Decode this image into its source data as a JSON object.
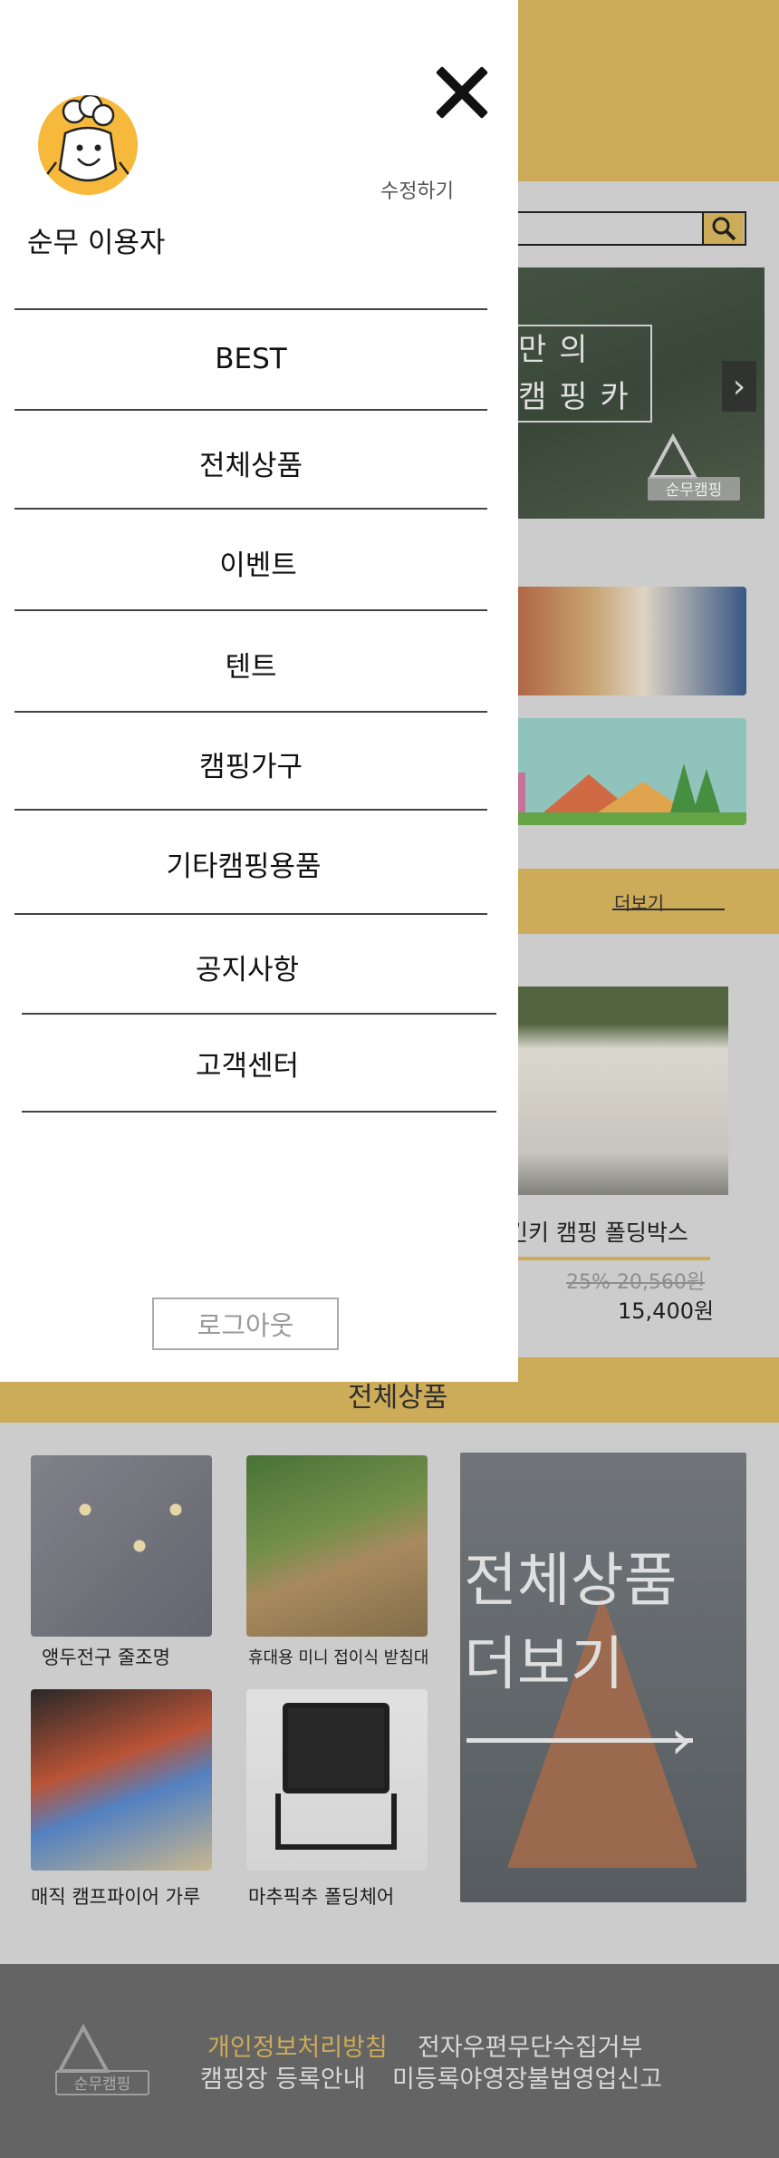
{
  "background": {
    "best": {
      "more_label": "더보기",
      "product": {
        "name": "킨키 캠핑 폴딩박스",
        "old_price": "25% 20,560원",
        "price": "15,400원"
      }
    },
    "all_products": {
      "title": "전체상품",
      "items": [
        {
          "label": "앵두전구 줄조명"
        },
        {
          "label": "휴대용 미니 접이식 받침대"
        },
        {
          "label": "매직 캠프파이어 가루"
        },
        {
          "label": "마추픽추 폴딩체어"
        }
      ],
      "promo_line1": "전체상품",
      "promo_line2": "더보기"
    },
    "banner": {
      "line1": "만의",
      "line2": "캠핑카",
      "logo_text": "순무캠핑"
    },
    "footer": {
      "logo_text": "순무캠핑",
      "links": [
        "개인정보처리방침",
        "전자우편무단수집거부",
        "캠핑장 등록안내",
        "미등록야영장불법영업신고"
      ]
    },
    "colors": {
      "accent": "#dcb960",
      "footer": "#6c6c6c"
    }
  },
  "drawer": {
    "close_icon": "close-icon",
    "edit_label": "수정하기",
    "username": "순무 이용자",
    "menu": [
      "BEST",
      "전체상품",
      "이벤트",
      "텐트",
      "캠핑가구",
      "기타캠핑용품",
      "공지사항",
      "고객센터"
    ],
    "logout_label": "로그아웃"
  }
}
